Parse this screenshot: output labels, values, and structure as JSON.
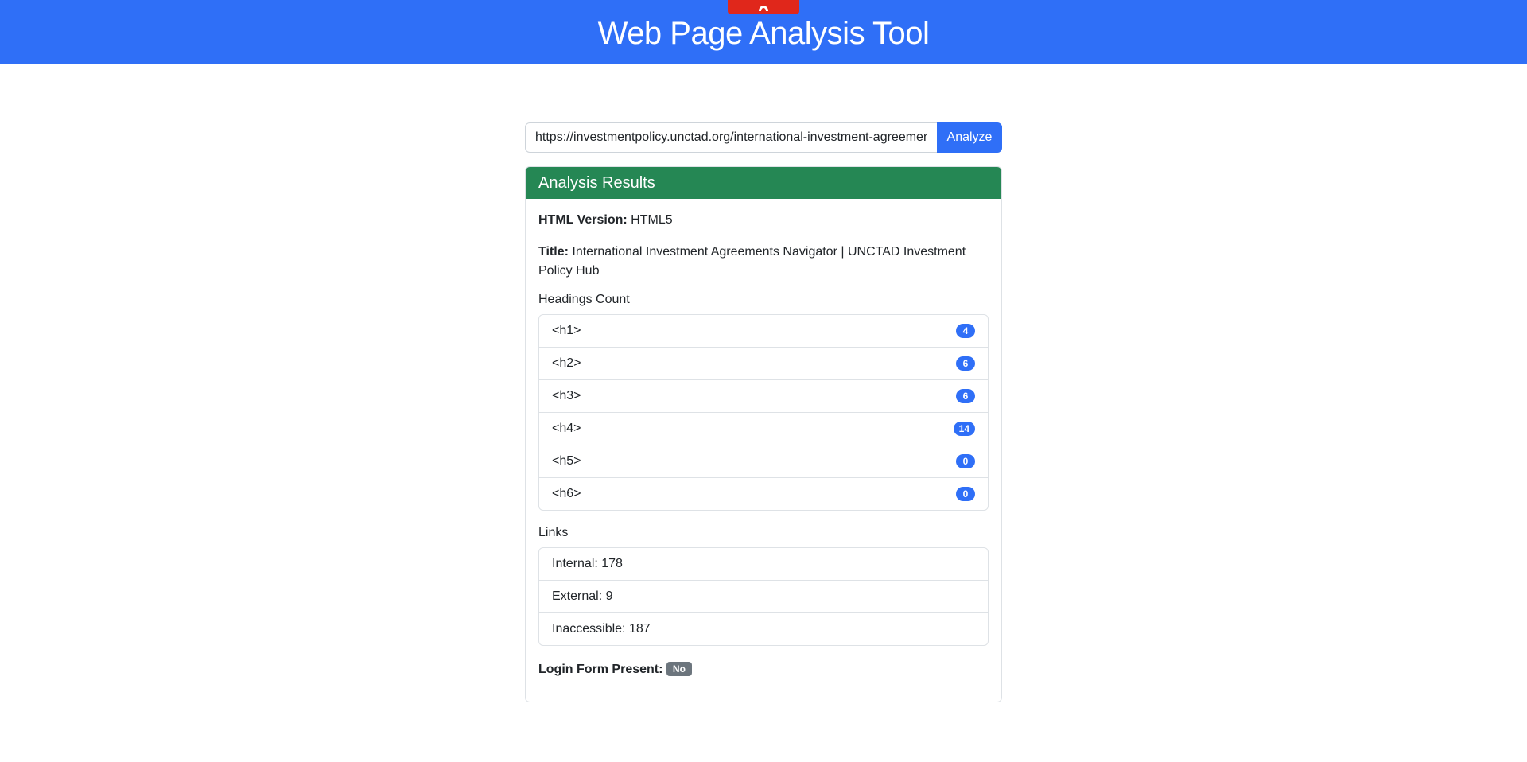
{
  "header": {
    "title": "Web Page Analysis Tool"
  },
  "search": {
    "url_value": "https://investmentpolicy.unctad.org/international-investment-agreements/",
    "analyze_label": "Analyze"
  },
  "results": {
    "card_title": "Analysis Results",
    "html_version_label": "HTML Version:",
    "html_version_value": "HTML5",
    "title_label": "Title:",
    "title_value": "International Investment Agreements Navigator | UNCTAD Investment Policy Hub",
    "headings_label": "Headings Count",
    "headings": [
      {
        "tag": "<h1>",
        "count": "4"
      },
      {
        "tag": "<h2>",
        "count": "6"
      },
      {
        "tag": "<h3>",
        "count": "6"
      },
      {
        "tag": "<h4>",
        "count": "14"
      },
      {
        "tag": "<h5>",
        "count": "0"
      },
      {
        "tag": "<h6>",
        "count": "0"
      }
    ],
    "links_label": "Links",
    "links": {
      "internal": "Internal: 178",
      "external": "External: 9",
      "inaccessible": "Inaccessible: 187"
    },
    "login_form_label": "Login Form Present:",
    "login_form_value": "No"
  },
  "colors": {
    "header_bg": "#2f6ff7",
    "card_header_bg": "#258754",
    "badge_primary": "#2f6ff7",
    "badge_secondary": "#6c757d",
    "top_tab": "#e0271b"
  },
  "icons": {
    "top_tab_icon": "arch-icon"
  }
}
